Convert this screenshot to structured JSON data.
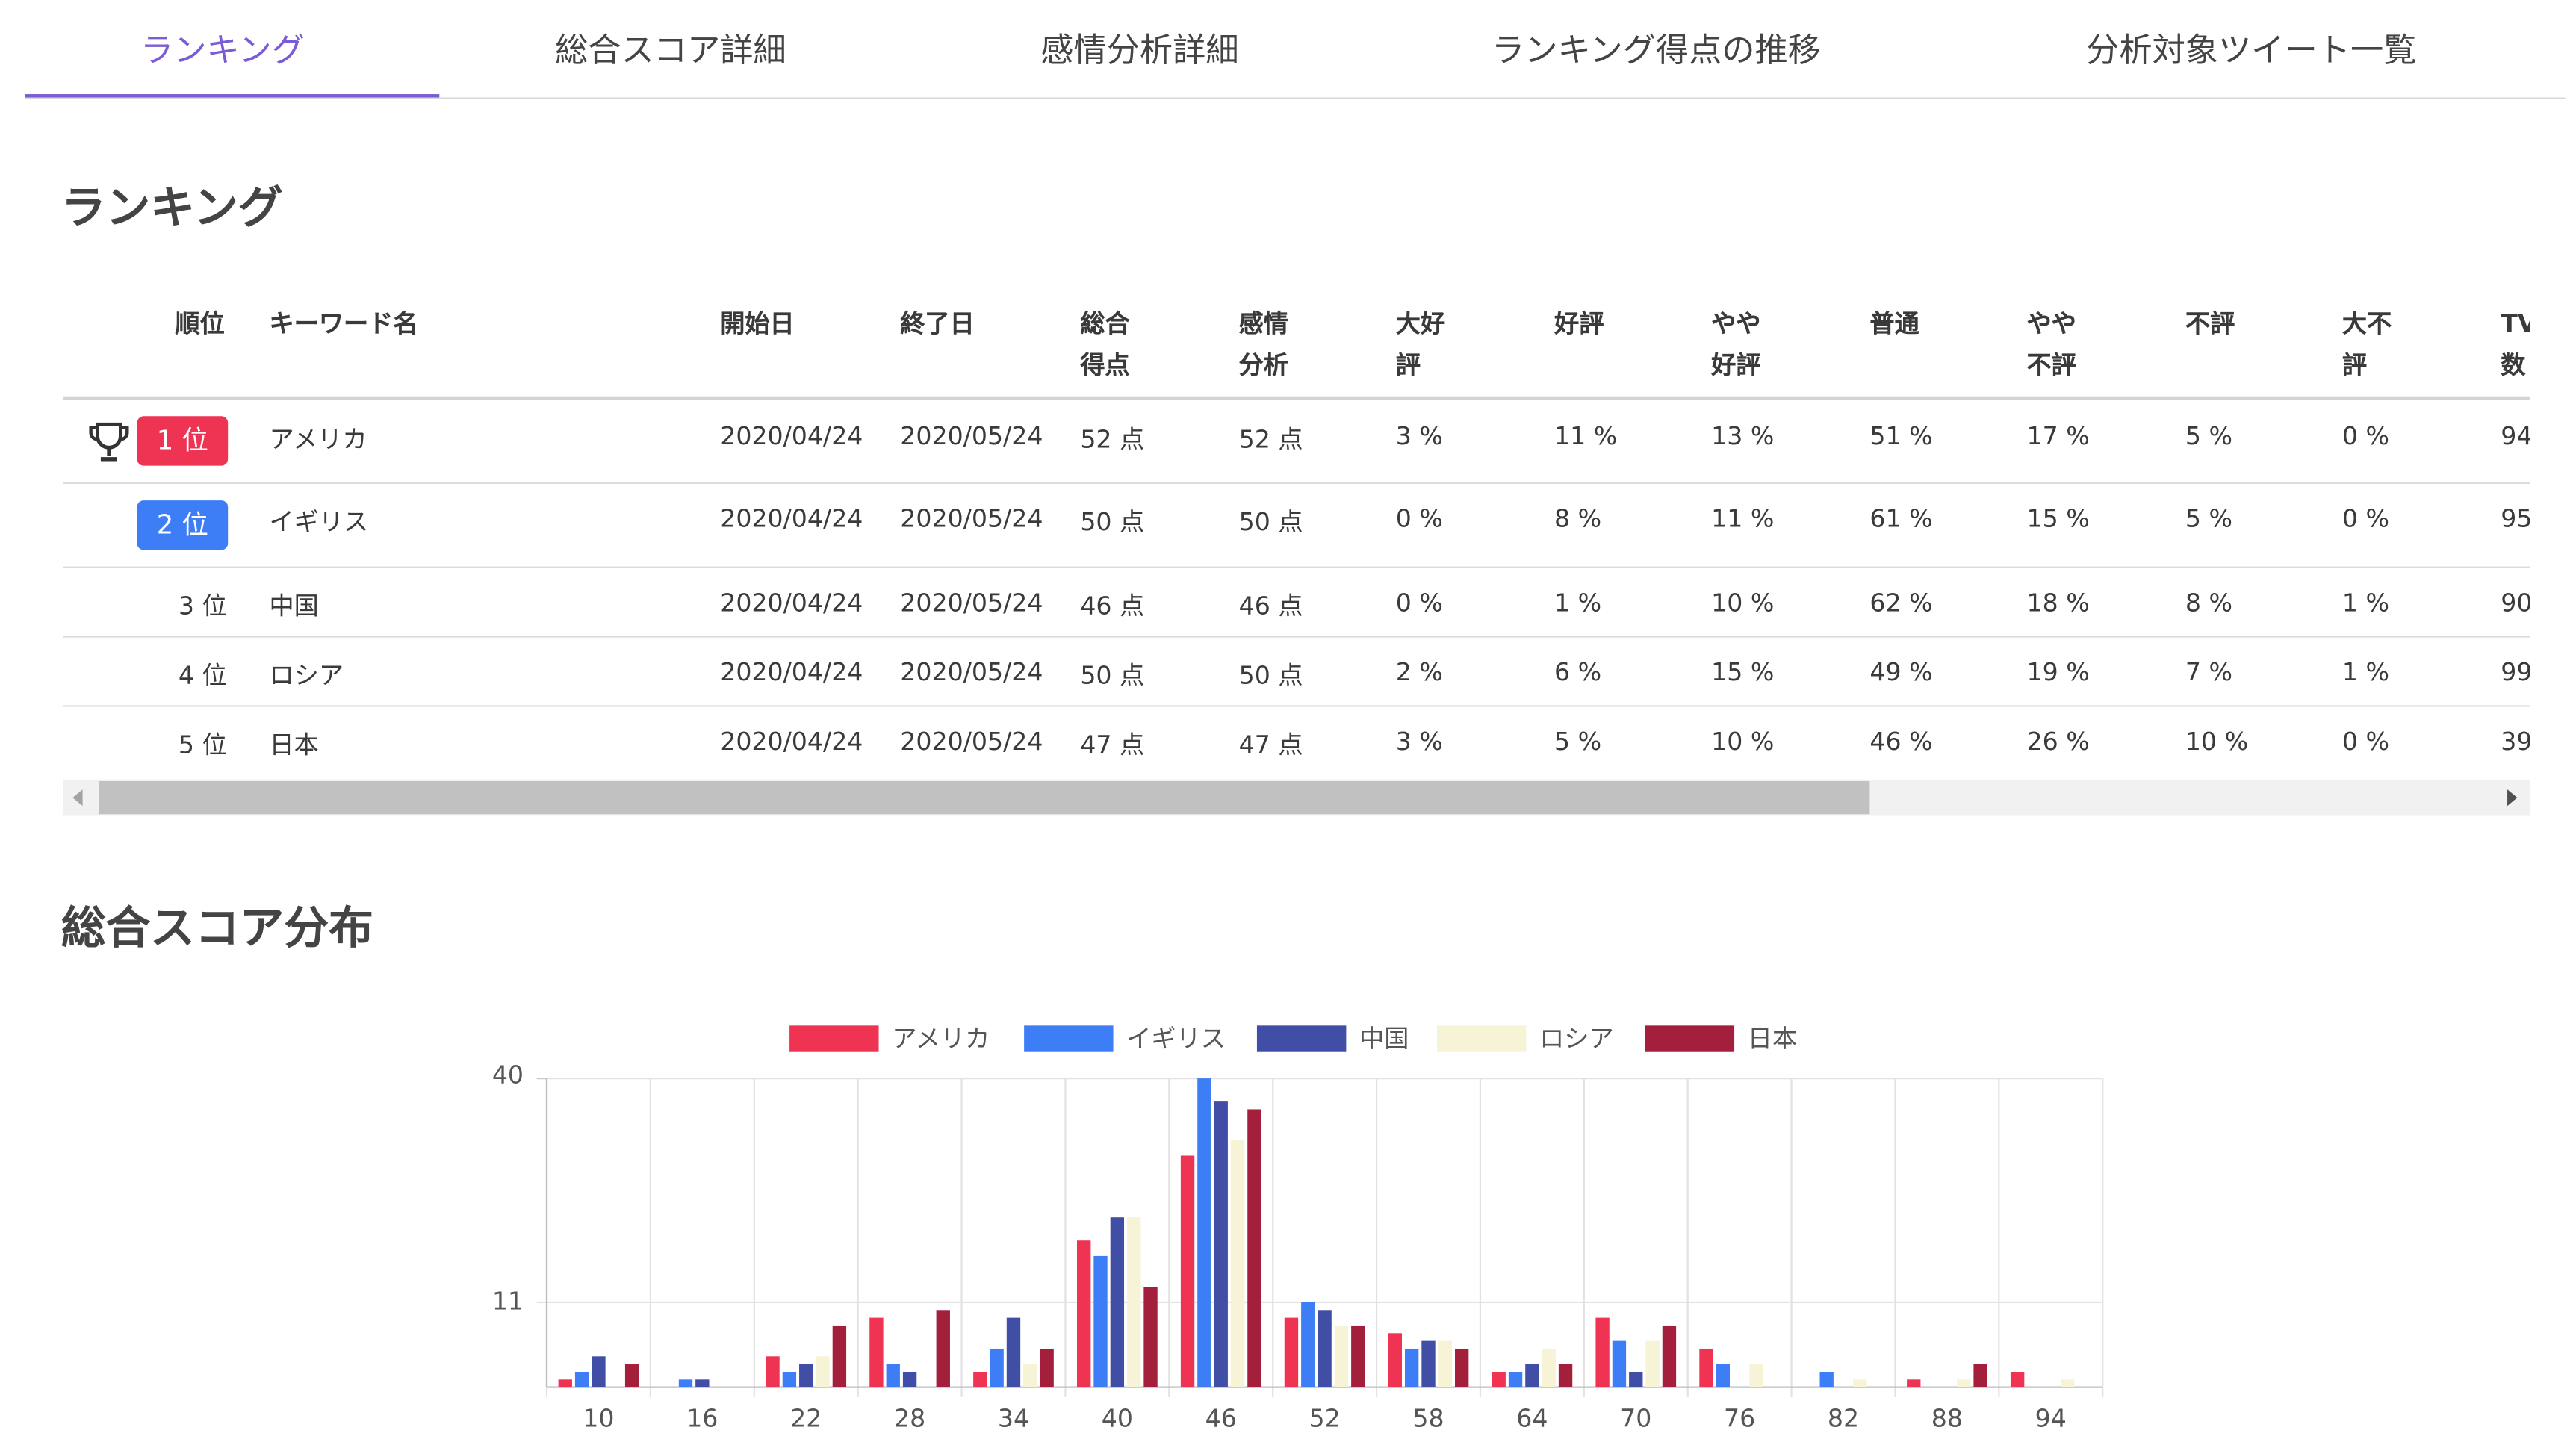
{
  "tabs": [
    {
      "label": "ランキング",
      "active": true
    },
    {
      "label": "総合スコア詳細",
      "active": false
    },
    {
      "label": "感情分析詳細",
      "active": false
    },
    {
      "label": "ランキング得点の推移",
      "active": false
    },
    {
      "label": "分析対象ツイート一覧",
      "active": false
    }
  ],
  "ranking": {
    "title": "ランキング",
    "headers": {
      "rank": "順位",
      "keyword": "キーワード名",
      "start": "開始日",
      "end": "終了日",
      "total": [
        "総合",
        "得点"
      ],
      "sentiment": [
        "感情",
        "分析"
      ],
      "very_good": [
        "大好",
        "評"
      ],
      "good": [
        "好評"
      ],
      "somewhat_good": [
        "やや",
        "好評"
      ],
      "neutral": [
        "普通"
      ],
      "somewhat_bad": [
        "やや",
        "不評"
      ],
      "bad": [
        "不評"
      ],
      "very_bad": [
        "大不",
        "評"
      ],
      "tv": [
        "TV",
        "数"
      ]
    },
    "rows": [
      {
        "rank": "1 位",
        "keyword": "アメリカ",
        "start": "2020/04/24",
        "end": "2020/05/24",
        "total": "52 点",
        "sentiment": "52 点",
        "very_good": "3 %",
        "good": "11 %",
        "somewhat_good": "13 %",
        "neutral": "51 %",
        "somewhat_bad": "17 %",
        "bad": "5 %",
        "very_bad": "0 %",
        "tv": "94"
      },
      {
        "rank": "2 位",
        "keyword": "イギリス",
        "start": "2020/04/24",
        "end": "2020/05/24",
        "total": "50 点",
        "sentiment": "50 点",
        "very_good": "0 %",
        "good": "8 %",
        "somewhat_good": "11 %",
        "neutral": "61 %",
        "somewhat_bad": "15 %",
        "bad": "5 %",
        "very_bad": "0 %",
        "tv": "95"
      },
      {
        "rank": "3 位",
        "keyword": "中国",
        "start": "2020/04/24",
        "end": "2020/05/24",
        "total": "46 点",
        "sentiment": "46 点",
        "very_good": "0 %",
        "good": "1 %",
        "somewhat_good": "10 %",
        "neutral": "62 %",
        "somewhat_bad": "18 %",
        "bad": "8 %",
        "very_bad": "1 %",
        "tv": "90"
      },
      {
        "rank": "4 位",
        "keyword": "ロシア",
        "start": "2020/04/24",
        "end": "2020/05/24",
        "total": "50 点",
        "sentiment": "50 点",
        "very_good": "2 %",
        "good": "6 %",
        "somewhat_good": "15 %",
        "neutral": "49 %",
        "somewhat_bad": "19 %",
        "bad": "7 %",
        "very_bad": "1 %",
        "tv": "99"
      },
      {
        "rank": "5 位",
        "keyword": "日本",
        "start": "2020/04/24",
        "end": "2020/05/24",
        "total": "47 点",
        "sentiment": "47 点",
        "very_good": "3 %",
        "good": "5 %",
        "somewhat_good": "10 %",
        "neutral": "46 %",
        "somewhat_bad": "26 %",
        "bad": "10 %",
        "very_bad": "0 %",
        "tv": "39"
      }
    ],
    "badge_colors": [
      "#ef3453",
      "#3d7ef6"
    ],
    "trophy_icon": "trophy-icon"
  },
  "distribution": {
    "title": "総合スコア分布"
  },
  "chart_data": {
    "type": "bar",
    "categories": [
      "10",
      "16",
      "22",
      "28",
      "34",
      "40",
      "46",
      "52",
      "58",
      "64",
      "70",
      "76",
      "82",
      "88",
      "94"
    ],
    "yticks": [
      "40",
      "11"
    ],
    "ylim": [
      0,
      40
    ],
    "grid": true,
    "legend": "top",
    "series": [
      {
        "name": "アメリカ",
        "color": "#ef3453",
        "values": [
          1,
          0,
          4,
          9,
          2,
          19,
          30,
          9,
          7,
          2,
          9,
          5,
          0,
          1,
          2
        ]
      },
      {
        "name": "イギリス",
        "color": "#3d7ef6",
        "values": [
          2,
          1,
          2,
          3,
          5,
          17,
          40,
          11,
          5,
          2,
          6,
          3,
          2,
          0,
          0
        ]
      },
      {
        "name": "中国",
        "color": "#414ea5",
        "values": [
          4,
          1,
          3,
          2,
          9,
          22,
          37,
          10,
          6,
          3,
          2,
          0,
          0,
          0,
          0
        ]
      },
      {
        "name": "ロシア",
        "color": "#f7f3d6",
        "values": [
          0,
          0,
          4,
          0,
          3,
          22,
          32,
          8,
          6,
          5,
          6,
          3,
          1,
          1,
          1
        ]
      },
      {
        "name": "日本",
        "color": "#a31f3b",
        "values": [
          3,
          0,
          8,
          10,
          5,
          13,
          36,
          8,
          5,
          3,
          8,
          0,
          0,
          3,
          0
        ]
      }
    ]
  }
}
